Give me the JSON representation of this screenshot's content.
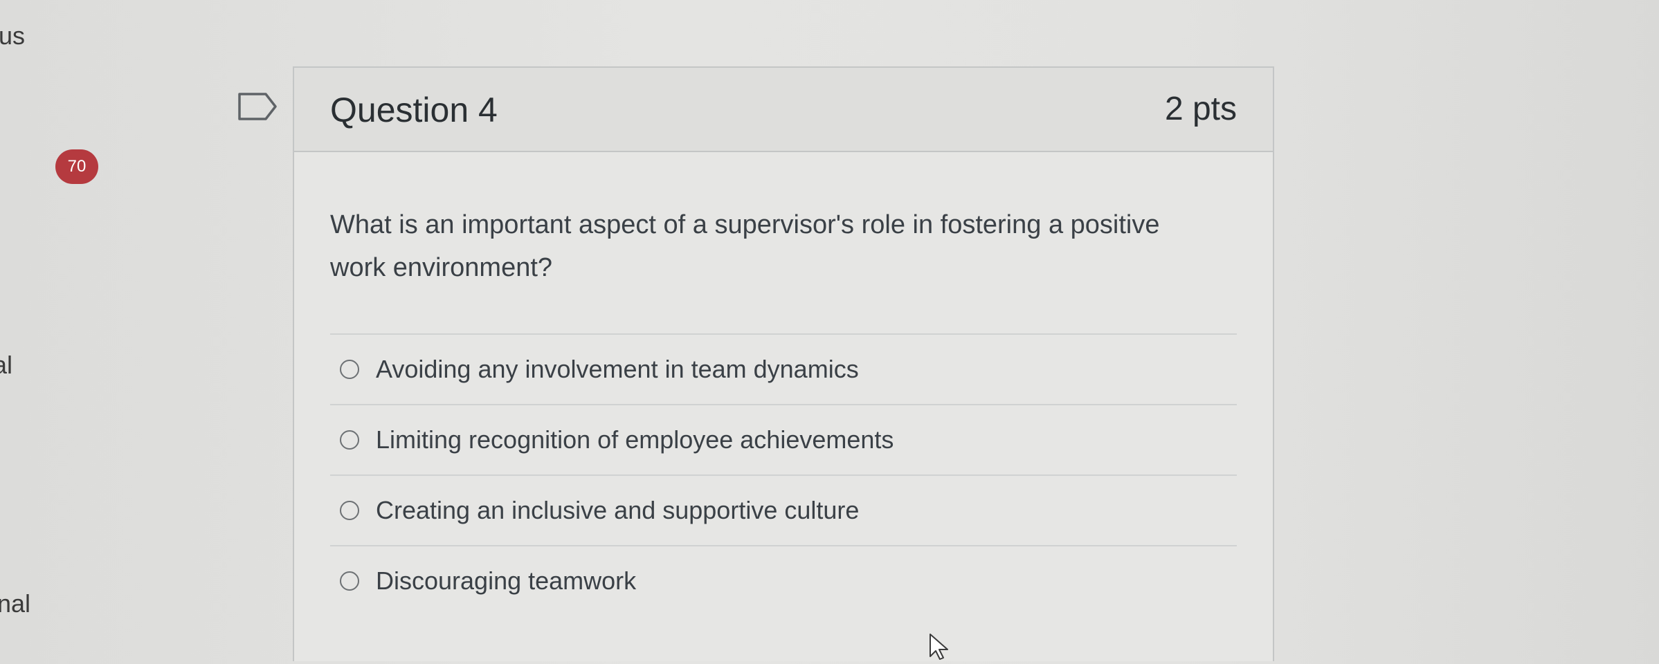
{
  "sidebar": {
    "top_text": "us",
    "mid_text": "al",
    "bottom_text": "nal",
    "badge": "70"
  },
  "question": {
    "title": "Question 4",
    "points": "2 pts",
    "text": "What is an important aspect of a supervisor's role in fostering a positive work environment?",
    "answers": [
      {
        "label": "Avoiding any involvement in team dynamics",
        "selected": false
      },
      {
        "label": "Limiting recognition of employee achievements",
        "selected": false
      },
      {
        "label": "Creating an inclusive and supportive culture",
        "selected": false
      },
      {
        "label": "Discouraging teamwork",
        "selected": false
      }
    ]
  },
  "icons": {
    "flag": "flag-outline-icon",
    "radio": "radio-empty-icon",
    "cursor": "mouse-pointer-icon"
  },
  "colors": {
    "badge_bg": "#b53a3f",
    "border": "#c4c6c6",
    "text": "#2a2f33"
  }
}
